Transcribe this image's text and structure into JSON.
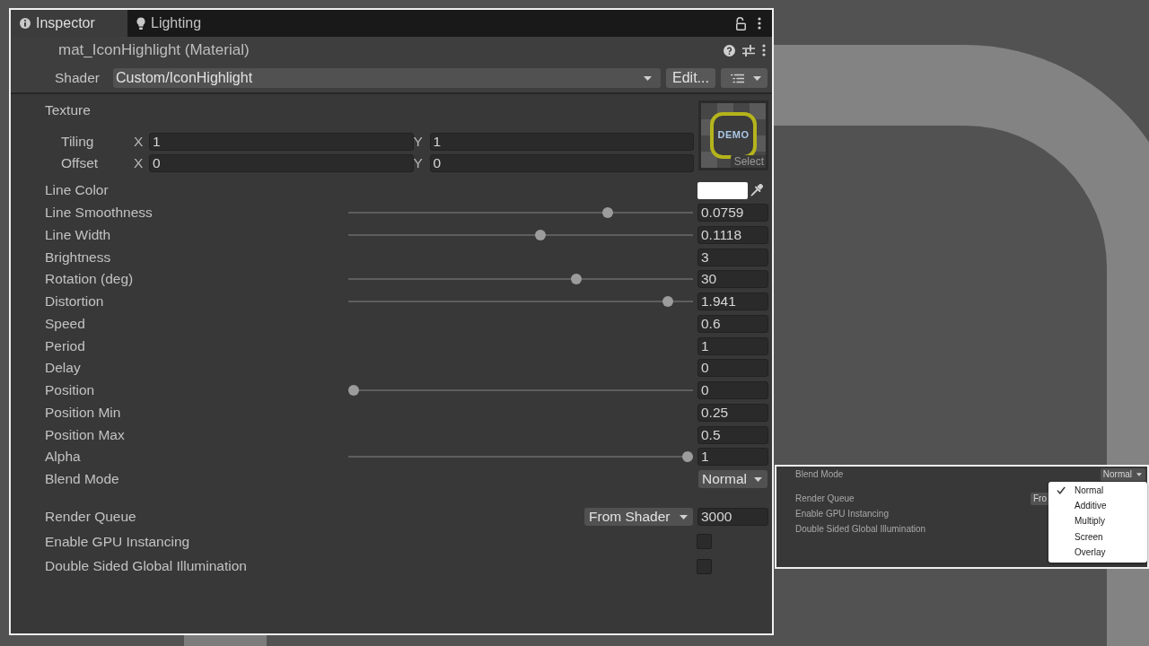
{
  "tabs": [
    {
      "label": "Inspector",
      "selected": true
    },
    {
      "label": "Lighting",
      "selected": false
    }
  ],
  "header": {
    "title": "mat_IconHighlight (Material)",
    "shader_label": "Shader",
    "shader": "Custom/IconHighlight",
    "edit_button": "Edit..."
  },
  "texture": {
    "label": "Texture",
    "vectors": [
      {
        "label": "Tiling",
        "components": [
          {
            "axis": "X",
            "value": "1"
          },
          {
            "axis": "Y",
            "value": "1"
          }
        ]
      },
      {
        "label": "Offset",
        "components": [
          {
            "axis": "X",
            "value": "0"
          },
          {
            "axis": "Y",
            "value": "0"
          }
        ]
      }
    ],
    "preview_text": "DEMO",
    "select_button": "Select"
  },
  "properties": [
    {
      "kind": "color",
      "label": "Line Color",
      "color": "#ffffff"
    },
    {
      "kind": "slider",
      "label": "Line Smoothness",
      "level": 0.76,
      "value": "0.0759"
    },
    {
      "kind": "slider",
      "label": "Line Width",
      "level": 0.56,
      "value": "0.1118"
    },
    {
      "kind": "float",
      "label": "Brightness",
      "value": "3"
    },
    {
      "kind": "slider",
      "label": "Rotation (deg)",
      "level": 0.667,
      "value": "30"
    },
    {
      "kind": "slider",
      "label": "Distortion",
      "level": 0.94,
      "value": "1.941"
    },
    {
      "kind": "float",
      "label": "Speed",
      "value": "0.6"
    },
    {
      "kind": "float",
      "label": "Period",
      "value": "1"
    },
    {
      "kind": "float",
      "label": "Delay",
      "value": "0"
    },
    {
      "kind": "slider",
      "label": "Position",
      "level": 0,
      "value": "0"
    },
    {
      "kind": "float",
      "label": "Position Min",
      "value": "0.25"
    },
    {
      "kind": "float",
      "label": "Position Max",
      "value": "0.5"
    },
    {
      "kind": "slider",
      "label": "Alpha",
      "level": 1,
      "value": "1"
    },
    {
      "kind": "dropdown",
      "label": "Blend Mode",
      "value": "Normal"
    }
  ],
  "advanced": [
    {
      "kind": "queue",
      "label": "Render Queue",
      "source": "From Shader",
      "value": "3000"
    },
    {
      "kind": "checkbox",
      "label": "Enable GPU Instancing",
      "checked": false
    },
    {
      "kind": "checkbox",
      "label": "Double Sided Global Illumination",
      "checked": false
    }
  ],
  "inset": {
    "rows": [
      {
        "kind": "dropdown",
        "label": "Blend Mode",
        "value": "Normal"
      },
      {
        "kind": "partial_dropdown",
        "label": "Render Queue",
        "value": "Fro"
      },
      {
        "kind": "plain",
        "label": "Enable GPU Instancing"
      },
      {
        "kind": "plain",
        "label": "Double Sided Global Illumination"
      }
    ],
    "menu": [
      {
        "label": "Normal",
        "selected": true
      },
      {
        "label": "Additive",
        "selected": false
      },
      {
        "label": "Multiply",
        "selected": false
      },
      {
        "label": "Screen",
        "selected": false
      },
      {
        "label": "Overlay",
        "selected": false
      }
    ]
  }
}
